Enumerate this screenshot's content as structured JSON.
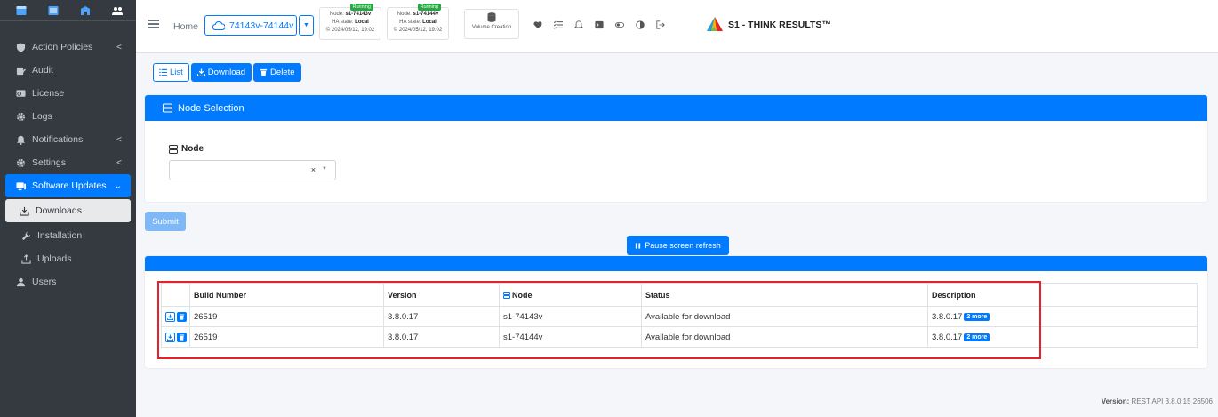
{
  "sidebar": {
    "items": [
      {
        "label": "Action Policies",
        "icon": "shield-icon",
        "has_chevron": true
      },
      {
        "label": "Audit",
        "icon": "clipboard-icon",
        "has_chevron": false
      },
      {
        "label": "License",
        "icon": "certificate-icon",
        "has_chevron": false
      },
      {
        "label": "Logs",
        "icon": "gear-icon",
        "has_chevron": false
      },
      {
        "label": "Notifications",
        "icon": "bell-icon",
        "has_chevron": true
      },
      {
        "label": "Settings",
        "icon": "gear-icon",
        "has_chevron": true
      },
      {
        "label": "Software Updates",
        "icon": "display-icon",
        "has_chevron": true,
        "active": true
      },
      {
        "label": "Downloads",
        "icon": "download-tray-icon",
        "sub": true,
        "active": true
      },
      {
        "label": "Installation",
        "icon": "wrench-icon",
        "sub": true
      },
      {
        "label": "Uploads",
        "icon": "upload-tray-icon",
        "sub": true
      },
      {
        "label": "Users",
        "icon": "user-icon",
        "has_chevron": false
      }
    ],
    "chevron": "<",
    "chevron_open": "⌄"
  },
  "header": {
    "home": "Home",
    "cluster": "74143v-74144v",
    "nodes": [
      {
        "node_prefix": "Node: ",
        "node": "s1-74143v",
        "ha_prefix": "HA state: ",
        "ha": "Local",
        "time": "© 2024/05/12, 19:02",
        "status": "Running"
      },
      {
        "node_prefix": "Node: ",
        "node": "s1-74144v",
        "ha_prefix": "HA state: ",
        "ha": "Local",
        "time": "© 2024/05/12, 19:02",
        "status": "Running"
      }
    ],
    "volume_creation": "Volume Creation",
    "brand": "S1 - THINK RESULTS™"
  },
  "toolbar": {
    "list": "List",
    "download": "Download",
    "delete": "Delete"
  },
  "node_selection": {
    "title": "Node Selection",
    "label": "Node",
    "clear": "×",
    "caret": "▼"
  },
  "submit": "Submit",
  "pause": "Pause screen refresh",
  "table": {
    "headers": [
      "",
      "Build Number",
      "Version",
      "Node",
      "Status",
      "Description"
    ],
    "rows": [
      {
        "build": "26519",
        "version": "3.8.0.17",
        "node": "s1-74143v",
        "status": "Available for download",
        "description": "3.8.0.17",
        "more": "2 more"
      },
      {
        "build": "26519",
        "version": "3.8.0.17",
        "node": "s1-74144v",
        "status": "Available for download",
        "description": "3.8.0.17",
        "more": "2 more"
      }
    ]
  },
  "footer": {
    "version_label": "Version:",
    "version_value": "REST API 3.8.0.15 26506"
  },
  "colors": {
    "primary": "#007bff",
    "sidebar_bg": "#343a40",
    "running": "#28a745",
    "highlight": "#e5212b"
  }
}
